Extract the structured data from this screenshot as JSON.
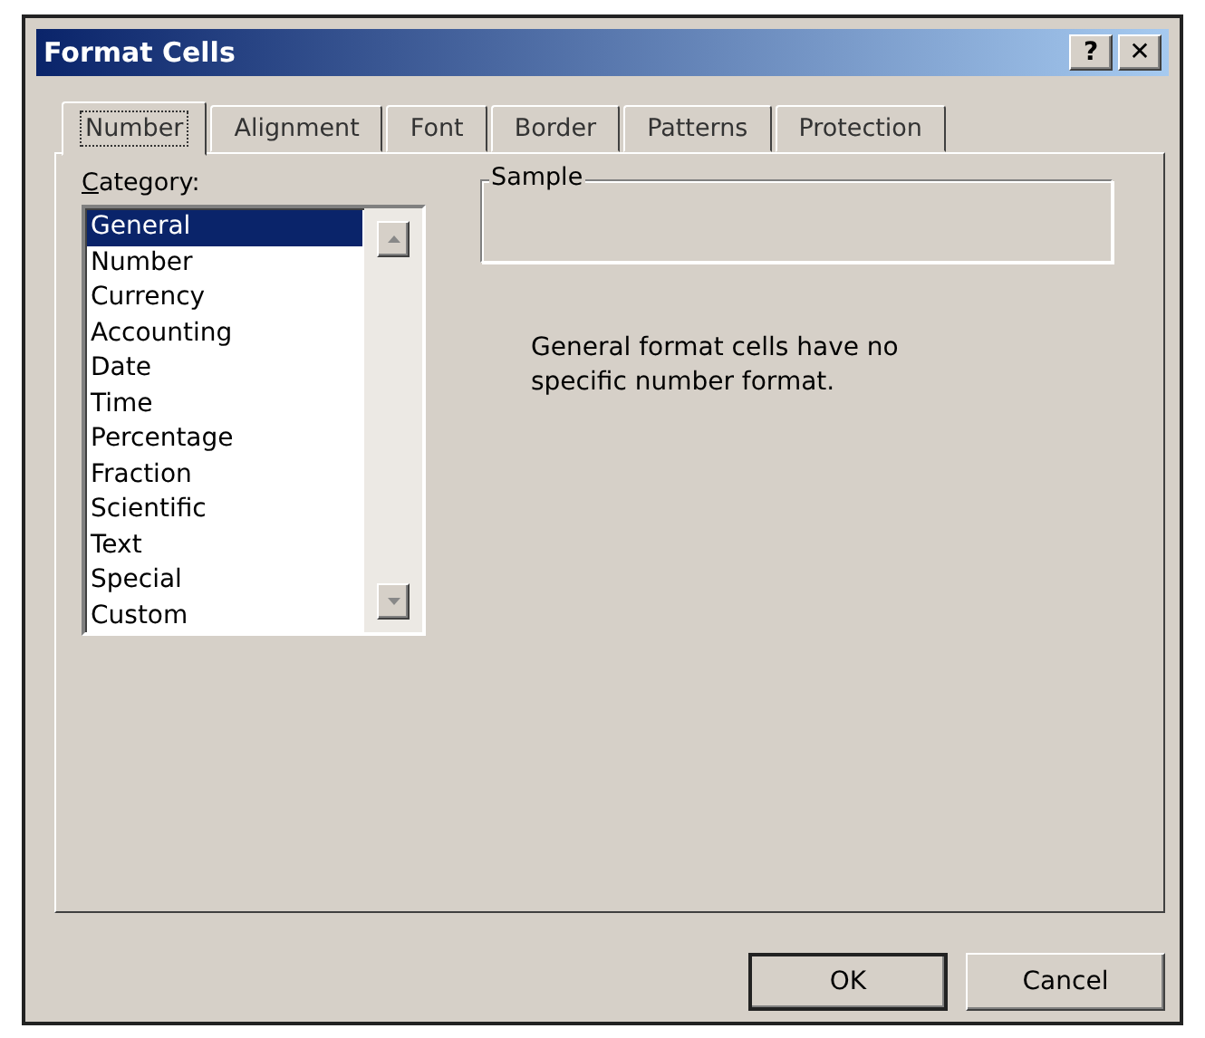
{
  "window": {
    "title": "Format Cells",
    "title_buttons": [
      "?",
      "✕"
    ]
  },
  "tabs": [
    {
      "label": "Number",
      "selected": true
    },
    {
      "label": "Alignment",
      "selected": false
    },
    {
      "label": "Font",
      "selected": false
    },
    {
      "label": "Border",
      "selected": false
    },
    {
      "label": "Patterns",
      "selected": false
    },
    {
      "label": "Protection",
      "selected": false
    }
  ],
  "category": {
    "label": "Category:",
    "items": [
      {
        "label": "General",
        "selected": true
      },
      {
        "label": "Number",
        "selected": false
      },
      {
        "label": "Currency",
        "selected": false
      },
      {
        "label": "Accounting",
        "selected": false
      },
      {
        "label": "Date",
        "selected": false
      },
      {
        "label": "Time",
        "selected": false
      },
      {
        "label": "Percentage",
        "selected": false
      },
      {
        "label": "Fraction",
        "selected": false
      },
      {
        "label": "Scientific",
        "selected": false
      },
      {
        "label": "Text",
        "selected": false
      },
      {
        "label": "Special",
        "selected": false
      },
      {
        "label": "Custom",
        "selected": false
      }
    ]
  },
  "sample": {
    "label": "Sample"
  },
  "description": "General format cells have no specific number format.",
  "buttons": [
    {
      "label": "OK",
      "default": true
    },
    {
      "label": "Cancel",
      "default": false
    }
  ]
}
